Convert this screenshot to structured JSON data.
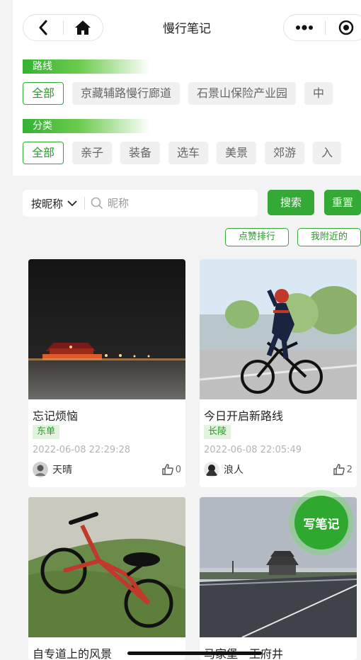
{
  "header": {
    "title": "慢行笔记",
    "back_icon": "chevron-left-icon",
    "home_icon": "home-icon",
    "more_icon": "more-dots-icon",
    "close_icon": "target-icon"
  },
  "filters": {
    "route": {
      "label": "路线",
      "options": [
        "全部",
        "京藏辅路慢行廊道",
        "石景山保险产业园",
        "中"
      ]
    },
    "category": {
      "label": "分类",
      "options": [
        "全部",
        "亲子",
        "装备",
        "选车",
        "美景",
        "郊游",
        "入"
      ]
    }
  },
  "search": {
    "sort_label": "按昵称",
    "placeholder": "昵称",
    "value": "",
    "search_button": "搜索",
    "reset_button": "重置"
  },
  "actions": {
    "rank_by_likes": "点赞排行",
    "nearby": "我附近的"
  },
  "notes": [
    {
      "title": "忘记烦恼",
      "area": "东单",
      "date": "2022-06-08 22:29:28",
      "author": "天晴",
      "likes": "0"
    },
    {
      "title": "今日开启新路线",
      "area": "长陵",
      "date": "2022-06-08 22:05:49",
      "author": "浪人",
      "likes": "2"
    },
    {
      "title": "自专道上的风景"
    },
    {
      "title": "马家堡—王府井"
    }
  ],
  "fab": {
    "label": "写笔记"
  },
  "colors": {
    "accent": "#35a935",
    "tag_bg": "#e2f4dd"
  }
}
